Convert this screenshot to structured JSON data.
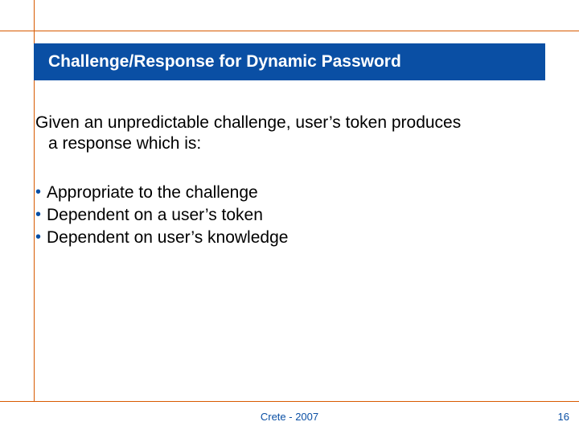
{
  "title": "Challenge/Response for Dynamic Password",
  "intro_line1": "Given an unpredictable challenge, user’s token produces",
  "intro_line2": "a response which is:",
  "bullets": [
    "Appropriate to the challenge",
    "Dependent on a user’s token",
    "Dependent on user’s knowledge"
  ],
  "footer": "Crete - 2007",
  "page_number": "16"
}
